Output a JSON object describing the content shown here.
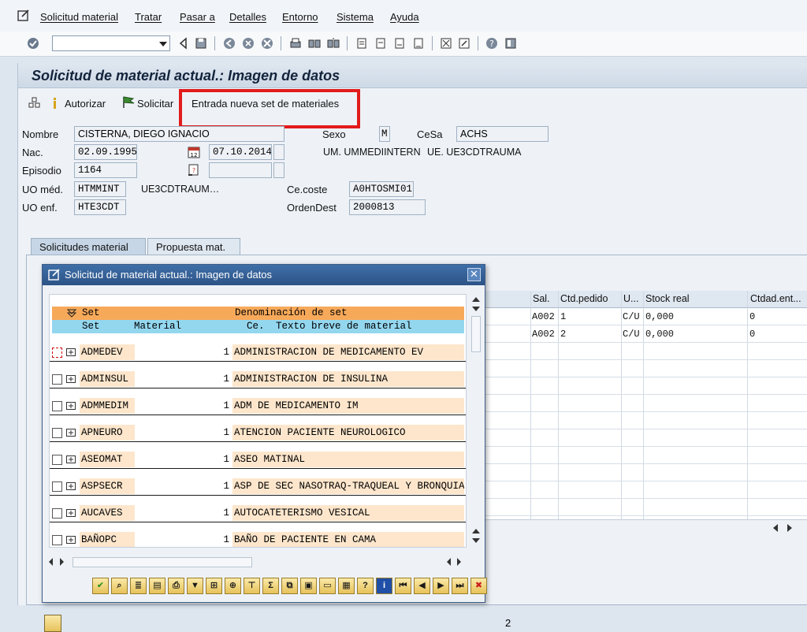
{
  "menu": {
    "items": [
      "Solicitud material",
      "Tratar",
      "Pasar a",
      "Detalles",
      "Entorno",
      "Sistema",
      "Ayuda"
    ]
  },
  "toolbar": {
    "command_value": "",
    "icons": [
      "enter-icon",
      "back-icon",
      "save-icon",
      "back-nav-icon",
      "exit-icon",
      "cancel-icon",
      "print-icon",
      "find-icon",
      "find-next-icon",
      "first-page-icon",
      "prev-page-icon",
      "next-page-icon",
      "last-page-icon",
      "new-session-icon",
      "shortcut-icon",
      "help-icon",
      "layout-icon"
    ]
  },
  "screen": {
    "title": "Solicitud de material actual.: Imagen de datos",
    "app_toolbar": {
      "authorize_label": "Autorizar",
      "request_label": "Solicitar",
      "new_set_label": "Entrada nueva set de materiales"
    }
  },
  "patient": {
    "nombre_label": "Nombre",
    "nombre": "CISTERNA, DIEGO IGNACIO",
    "sexo_label": "Sexo",
    "sexo": "M",
    "cesa_label": "CeSa",
    "cesa": "ACHS",
    "nac_label": "Nac.",
    "nac": "02.09.1995",
    "admission_date": "07.10.2014",
    "um_text": "UM. UMMEDIINTERN",
    "ue_text": "UE. UE3CDTRAUMA",
    "episodio_label": "Episodio",
    "episodio": "1164",
    "discharge_date": "",
    "uo_med_label": "UO méd.",
    "uo_med": "HTMMINT",
    "uo_med_text": "UE3CDTRAUM…",
    "ce_coste_label": "Ce.coste",
    "ce_coste": "A0HTOSMI01",
    "uo_enf_label": "UO enf.",
    "uo_enf": "HTE3CDT",
    "orden_label": "OrdenDest",
    "orden": "2000813"
  },
  "tabs": [
    "Solicitudes material",
    "Propuesta mat."
  ],
  "bg_table": {
    "headers": [
      "Sal.",
      "Ctd.pedido",
      "U...",
      "Stock real",
      "Ctdad.ent..."
    ],
    "rows": [
      {
        "sal": "A002",
        "ctd": "1",
        "u": "C/U",
        "stock": "0,000",
        "ent": "0"
      },
      {
        "sal": "A002",
        "ctd": "2",
        "u": "C/U",
        "stock": "0,000",
        "ent": "0"
      }
    ]
  },
  "status_number": "2",
  "popup": {
    "title": "Solicitud de material actual.: Imagen de datos",
    "header1": {
      "set": "Set",
      "denominacion": "Denominación de set"
    },
    "header2": {
      "set": "Set",
      "material": "Material",
      "ce": "Ce.",
      "texto": "Texto breve de material"
    },
    "rows": [
      {
        "code": "ADMEDEV",
        "qty": "1",
        "desc": "ADMINISTRACION DE MEDICAMENTO EV"
      },
      {
        "code": "ADMINSUL",
        "qty": "1",
        "desc": "ADMINISTRACION DE INSULINA"
      },
      {
        "code": "ADMMEDIM",
        "qty": "1",
        "desc": "ADM DE MEDICAMENTO IM"
      },
      {
        "code": "APNEURO",
        "qty": "1",
        "desc": "ATENCION PACIENTE NEUROLOGICO"
      },
      {
        "code": "ASEOMAT",
        "qty": "1",
        "desc": "ASEO MATINAL"
      },
      {
        "code": "ASPSECR",
        "qty": "1",
        "desc": "ASP DE SEC NASOTRAQ-TRAQUEAL Y BRONQUIA"
      },
      {
        "code": "AUCAVES",
        "qty": "1",
        "desc": "AUTOCATETERISMO VESICAL"
      },
      {
        "code": "BAÑOPC",
        "qty": "1",
        "desc": "BAÑO DE PACIENTE EN CAMA"
      }
    ],
    "toolbar_icons": [
      "check-icon",
      "zoom-icon",
      "details-icon",
      "select-icon",
      "print-icon",
      "filter-icon",
      "find-icon",
      "find-next-icon",
      "sort-icon",
      "sum-icon",
      "export-icon",
      "copy-icon",
      "layout-icon",
      "table-icon",
      "help-icon",
      "info-icon",
      "first-icon",
      "prev-icon",
      "next-icon",
      "last-icon",
      "cancel-icon"
    ]
  },
  "colors": {
    "highlight": "#e21b1b",
    "header_orange": "#f7a95a",
    "header_blue": "#93d7ef",
    "row_peach": "#fde6cc",
    "popup_title": "#2c5386"
  }
}
